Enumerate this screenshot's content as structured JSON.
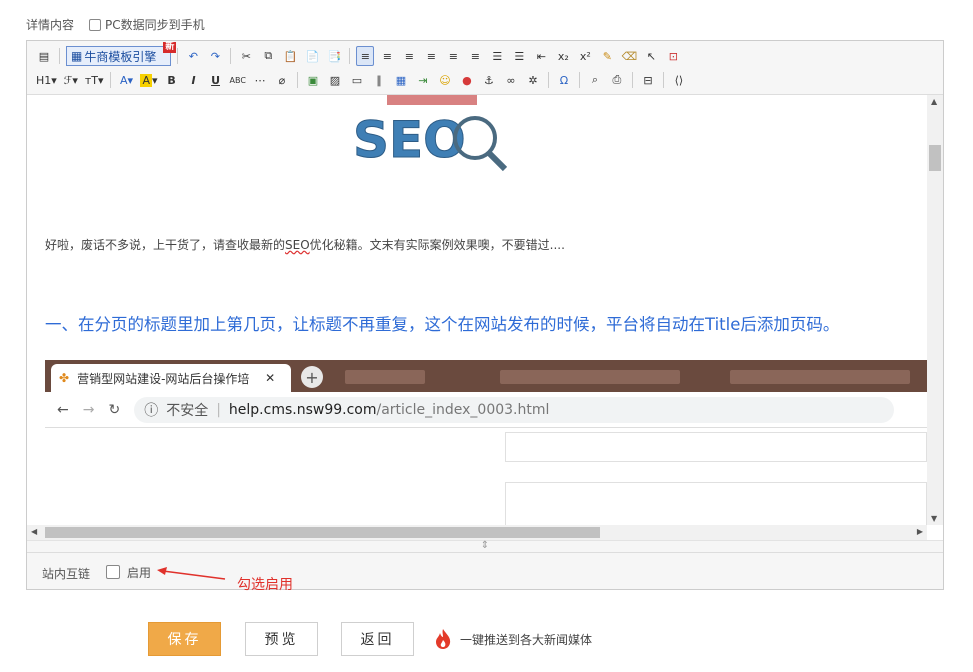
{
  "form": {
    "label": "详情内容",
    "sync_label": "PC数据同步到手机"
  },
  "toolbar": {
    "template_button": "牛商模板引擎",
    "new_badge": "新",
    "heading_label": "H1",
    "row1_icons": [
      "source-icon",
      "template-engine",
      "undo-icon",
      "redo-icon",
      "cut-icon",
      "copy-icon",
      "paste-icon",
      "paste-text-icon",
      "paste-word-icon",
      "align-left-icon",
      "align-center-icon",
      "align-right-icon",
      "align-justify-icon",
      "indent-left-icon",
      "indent-right-icon",
      "ordered-list-icon",
      "unordered-list-icon",
      "outdent-icon",
      "subscript-icon",
      "superscript-icon",
      "format-paint-icon",
      "clear-format-icon",
      "select-icon",
      "fullscreen-icon"
    ],
    "row2_icons": [
      "heading-dropdown",
      "font-family-dropdown",
      "font-size-dropdown",
      "font-color-icon",
      "highlight-icon",
      "bold-icon",
      "italic-icon",
      "underline-icon",
      "strikethrough-icon",
      "horizontal-rule-icon",
      "eraser-icon",
      "image-icon",
      "link-image-icon",
      "video-icon",
      "attachment-icon",
      "table-icon",
      "insert-row-icon",
      "emoji-icon",
      "map-pin-icon",
      "anchor-icon",
      "link-icon",
      "unlink-icon",
      "special-char-icon",
      "preview-icon",
      "print-icon",
      "page-break-icon",
      "code-icon"
    ]
  },
  "content": {
    "intro_before": "好啦，废话不多说，上干货了，请查收最新的",
    "intro_seo": "SEO",
    "intro_after": "优化秘籍。文末有实际案例效果噢，不要错过....",
    "heading": "一、在分页的标题里加上第几页，让标题不再重复，这个在网站发布的时候，平台将自动在Title后添加页码。",
    "seo_logo_text": "SEO",
    "browser": {
      "tab_title": "营销型网站建设-网站后台操作培",
      "insecure": "不安全",
      "url_host": "help.cms.nsw99.com",
      "url_path": "/article_index_0003.html"
    }
  },
  "internal_links": {
    "label": "站内互链",
    "checkbox_label": "启用",
    "annotation": "勾选启用"
  },
  "actions": {
    "save": "保存",
    "preview": "预览",
    "back": "返回",
    "push_text": "一键推送到各大新闻媒体"
  },
  "colors": {
    "accent_orange": "#f0a948",
    "heading_blue": "#2e6bd6",
    "annotation_red": "#e0312b"
  }
}
